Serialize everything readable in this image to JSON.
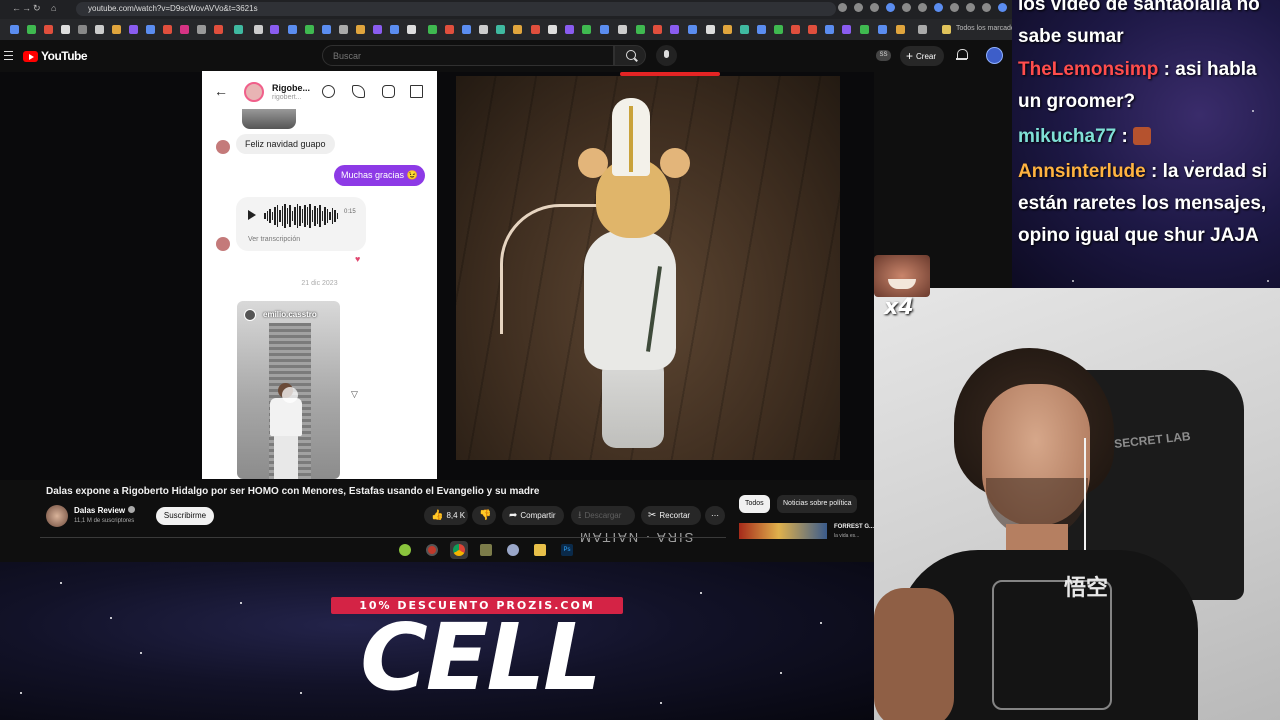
{
  "browser": {
    "url": "youtube.com/watch?v=D9scWovAVVo&t=3621s",
    "bookmarks_label": "Todos los marcadores"
  },
  "youtube": {
    "logo_text": "YouTube",
    "search_placeholder": "Buscar",
    "account_badge": "SS",
    "create_label": "Crear"
  },
  "dm": {
    "contact_name": "Rigobe...",
    "contact_handle": "rigobert...",
    "message_in": "Feliz navidad guapo",
    "message_out": "Muchas gracias 😉",
    "voice_duration": "0:15",
    "voice_transcript_label": "Ver transcripción",
    "date_separator": "21 dic 2023",
    "shared_reel_user": "emilio.casstro"
  },
  "video": {
    "overlay_text": "SIRA · NAITAM",
    "title": "Dalas expone a Rigoberto Hidalgo por ser HOMO con Menores, Estafas usando el Evangelio y su madre",
    "channel_name": "Dalas Review",
    "subscribers": "11,1 M de suscriptores",
    "subscribe_label": "Suscribirme",
    "likes": "8,4 K",
    "share_label": "Compartir",
    "download_label": "Descargar",
    "clip_label": "Recortar"
  },
  "sidebar": {
    "chips": [
      "Todos",
      "Noticias sobre política"
    ],
    "rec_title": "FORREST G...",
    "rec_sub": "la vida es..."
  },
  "stream": {
    "promo_banner": "10% DESCUENTO PROZIS.COM",
    "promo_word": "CELL",
    "emote_multiplier": "x4",
    "chair_brand": "SECRET LAB",
    "shirt_print": "悟空"
  },
  "chat": {
    "messages": [
      {
        "user": "",
        "text": "los video de santaolalla no sabe sumar"
      },
      {
        "user": "TheLemonsimp",
        "text": "asi habla un groomer?"
      },
      {
        "user": "mikucha77",
        "text": ""
      },
      {
        "user": "Annsinterlude",
        "text": "la verdad si están raretes los mensajes, opino igual que shur JAJA"
      }
    ]
  },
  "colors": {
    "youtube_red": "#ff0000",
    "dm_outgoing_bubble": "#8d3ae6",
    "promo_banner_bg": "#d42345",
    "chat_user_1": "#ff4d4d",
    "chat_user_2": "#7fe0d6",
    "chat_user_3": "#ffb340"
  }
}
